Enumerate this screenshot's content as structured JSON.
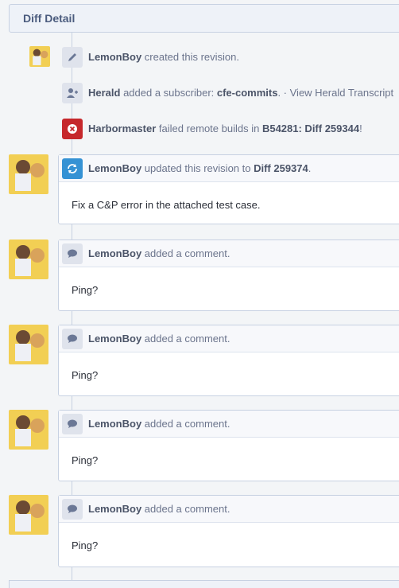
{
  "header": {
    "title": "Diff Detail"
  },
  "events": [
    {
      "icon": "pencil-icon",
      "actor": "LemonBoy",
      "text": " created this revision."
    },
    {
      "icon": "add-user-icon",
      "actor": "Herald",
      "text": " added a subscriber: ",
      "object": "cfe-commits",
      "suffix": ". · View Herald Transcript"
    },
    {
      "icon": "error-icon",
      "actor": "Harbormaster",
      "text": " failed remote builds in ",
      "object": "B54281: Diff 259344",
      "suffix": "!"
    }
  ],
  "cards": [
    {
      "icon": "refresh-icon",
      "actor": "LemonBoy",
      "text": " updated this revision to ",
      "object": "Diff 259374",
      "suffix": ".",
      "body": "Fix a C&P error in the attached test case."
    },
    {
      "icon": "comment-icon",
      "actor": "LemonBoy",
      "text": " added a comment.",
      "body": "Ping?"
    },
    {
      "icon": "comment-icon",
      "actor": "LemonBoy",
      "text": " added a comment.",
      "body": "Ping?"
    },
    {
      "icon": "comment-icon",
      "actor": "LemonBoy",
      "text": " added a comment.",
      "body": "Ping?"
    },
    {
      "icon": "comment-icon",
      "actor": "LemonBoy",
      "text": " added a comment.",
      "body": "Ping?"
    }
  ],
  "colors": {
    "accent": "#4b5c7e",
    "error": "#c6282c",
    "update": "#3592d4",
    "background": "#f3f5f7"
  }
}
